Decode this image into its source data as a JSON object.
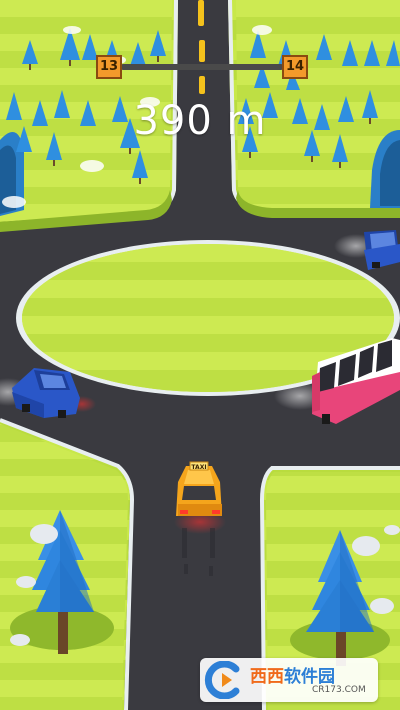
{
  "hud": {
    "level_current": "13",
    "level_next": "14",
    "level_progress": 0.0,
    "distance": "390 m"
  },
  "watermark": {
    "name_part1": "西西",
    "name_part2": "软件园",
    "url": "CR173.COM"
  },
  "vehicles": {
    "player_taxi_sign": "TAXI"
  },
  "colors": {
    "grass": "#c8e84a",
    "grass_stripe": "#b6d83c",
    "road": "#3a3a40",
    "curb": "#e8eef0",
    "tree": "#2f8fe0",
    "taxi": "#f5a51c",
    "blue_car": "#2a57c8",
    "bus_body": "#e8457a",
    "accent": "#f39a2b"
  }
}
